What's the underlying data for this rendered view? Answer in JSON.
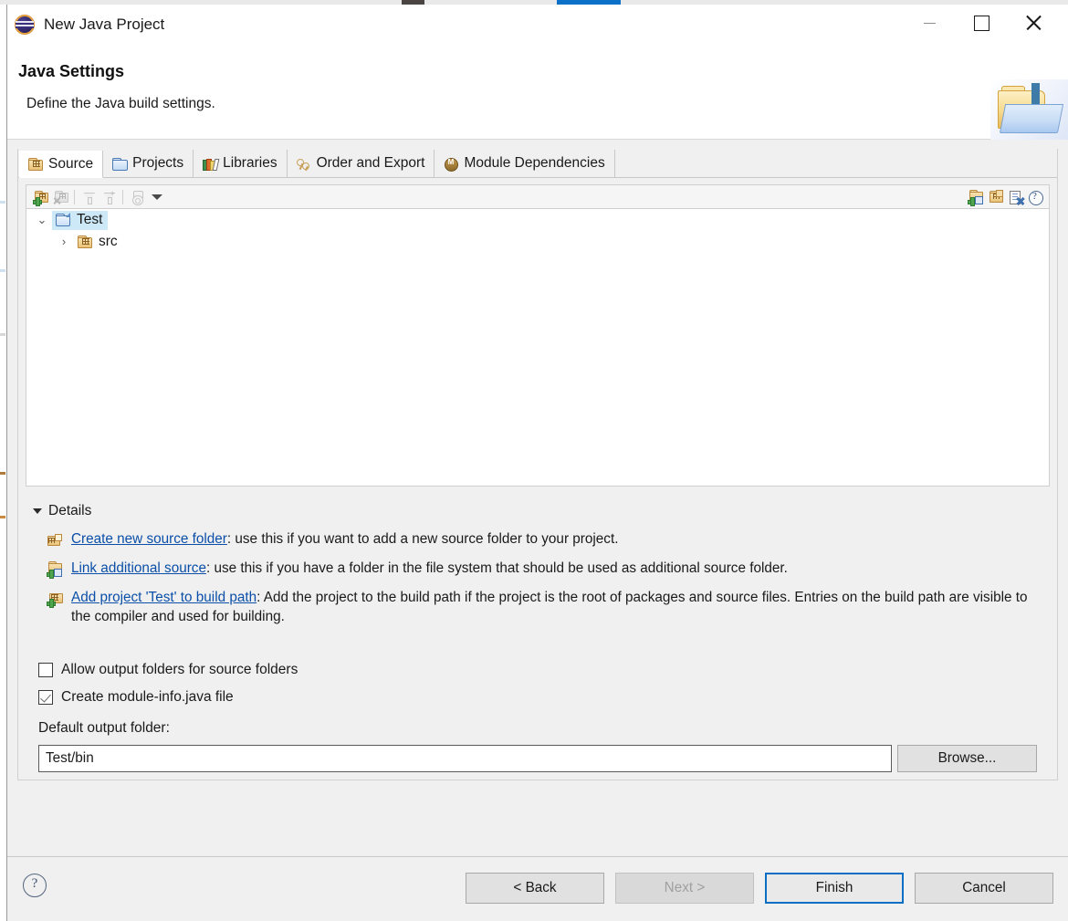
{
  "window": {
    "title": "New Java Project",
    "app_icon": "eclipse-icon",
    "minimize_label": "Minimize",
    "maximize_label": "Maximize",
    "close_label": "Close"
  },
  "header": {
    "title": "Java Settings",
    "subtitle": "Define the Java build settings.",
    "banner_icon": "java-project-folder-icon"
  },
  "tabs": [
    {
      "label": "Source",
      "icon": "source-folder-icon",
      "active": true
    },
    {
      "label": "Projects",
      "icon": "projects-folder-icon",
      "active": false
    },
    {
      "label": "Libraries",
      "icon": "libraries-books-icon",
      "active": false
    },
    {
      "label": "Order and Export",
      "icon": "order-export-icon",
      "active": false
    },
    {
      "label": "Module Dependencies",
      "icon": "module-dependencies-icon",
      "active": false
    }
  ],
  "tree_toolbar": {
    "left_buttons": [
      {
        "name": "add-source-folder-icon",
        "enabled": true
      },
      {
        "name": "remove-source-folder-icon",
        "enabled": false
      },
      {
        "name": "filter-inclusion-icon",
        "enabled": false
      },
      {
        "name": "filter-exclusion-icon",
        "enabled": false
      },
      {
        "name": "configure-output-icon",
        "enabled": false
      },
      {
        "name": "toolbar-dropdown-caret-icon",
        "enabled": true
      }
    ],
    "right_buttons": [
      {
        "name": "create-new-source-folder-icon",
        "enabled": true
      },
      {
        "name": "link-additional-source-icon",
        "enabled": true
      },
      {
        "name": "remove-entry-icon",
        "enabled": true
      },
      {
        "name": "help-icon",
        "enabled": true
      }
    ]
  },
  "tree": {
    "nodes": [
      {
        "label": "Test",
        "icon": "project-folder-icon",
        "expanded": true,
        "selected": true,
        "twisty": "⌄",
        "indent": 0
      },
      {
        "label": "src",
        "icon": "source-folder-icon",
        "expanded": false,
        "selected": false,
        "twisty": "›",
        "indent": 1
      }
    ]
  },
  "details": {
    "header": "Details",
    "lines": [
      {
        "icon": "create-new-source-folder-icon",
        "link": "Create new source folder",
        "text": ": use this if you want to add a new source folder to your project."
      },
      {
        "icon": "link-additional-source-icon",
        "link": "Link additional source",
        "text": ": use this if you have a folder in the file system that should be used as additional source folder."
      },
      {
        "icon": "add-project-to-build-path-icon",
        "link": "Add project 'Test' to build path",
        "text": ": Add the project to the build path if the project is the root of packages and source files. Entries on the build path are visible to the compiler and used for building."
      }
    ]
  },
  "options": {
    "allow_output_folders": {
      "label": "Allow output folders for source folders",
      "checked": false
    },
    "create_module_info": {
      "label": "Create module-info.java file",
      "checked": true
    }
  },
  "output_folder": {
    "label": "Default output folder:",
    "value": "Test/bin",
    "placeholder": "",
    "browse_label": "Browse..."
  },
  "footer": {
    "help_icon": "help-question-icon",
    "buttons": [
      {
        "label": "< Back",
        "state": "enabled",
        "name": "back-button"
      },
      {
        "label": "Next >",
        "state": "disabled",
        "name": "next-button"
      },
      {
        "label": "Finish",
        "state": "default",
        "name": "finish-button"
      },
      {
        "label": "Cancel",
        "state": "enabled",
        "name": "cancel-button"
      }
    ]
  },
  "colors": {
    "accent": "#0a6fc2",
    "link": "#0b4fa8",
    "selection": "#cde8f6",
    "dialog_bg": "#f0f0f0"
  }
}
